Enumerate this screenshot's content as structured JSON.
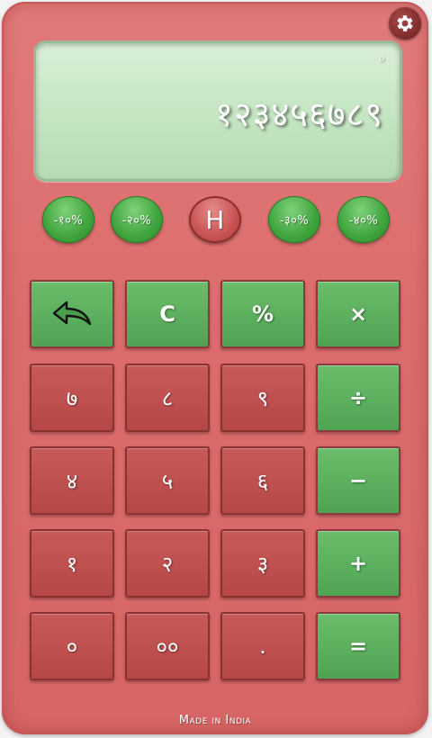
{
  "settings": {
    "icon": "gear-icon"
  },
  "display": {
    "memory_indicator": "°",
    "value": "१२३४५६७८९"
  },
  "percent_buttons": {
    "minus10": "-१०%",
    "minus20": "-२०%",
    "history": "H",
    "minus30": "-३०%",
    "minus40": "-४०%"
  },
  "keys": {
    "back_icon": "undo-arrow-icon",
    "clear": "C",
    "percent": "%",
    "multiply": "×",
    "seven": "७",
    "eight": "८",
    "nine": "९",
    "divide": "÷",
    "four": "४",
    "five": "५",
    "six": "६",
    "minus": "−",
    "one": "१",
    "two": "२",
    "three": "३",
    "plus": "+",
    "zero": "०",
    "double_zero": "००",
    "decimal": ".",
    "equals": "="
  },
  "footer": "Made in India",
  "colors": {
    "body": "#dc6c6c",
    "green_key": "#5aaf5c",
    "red_key": "#bf5050",
    "display": "#c6e6c4"
  }
}
